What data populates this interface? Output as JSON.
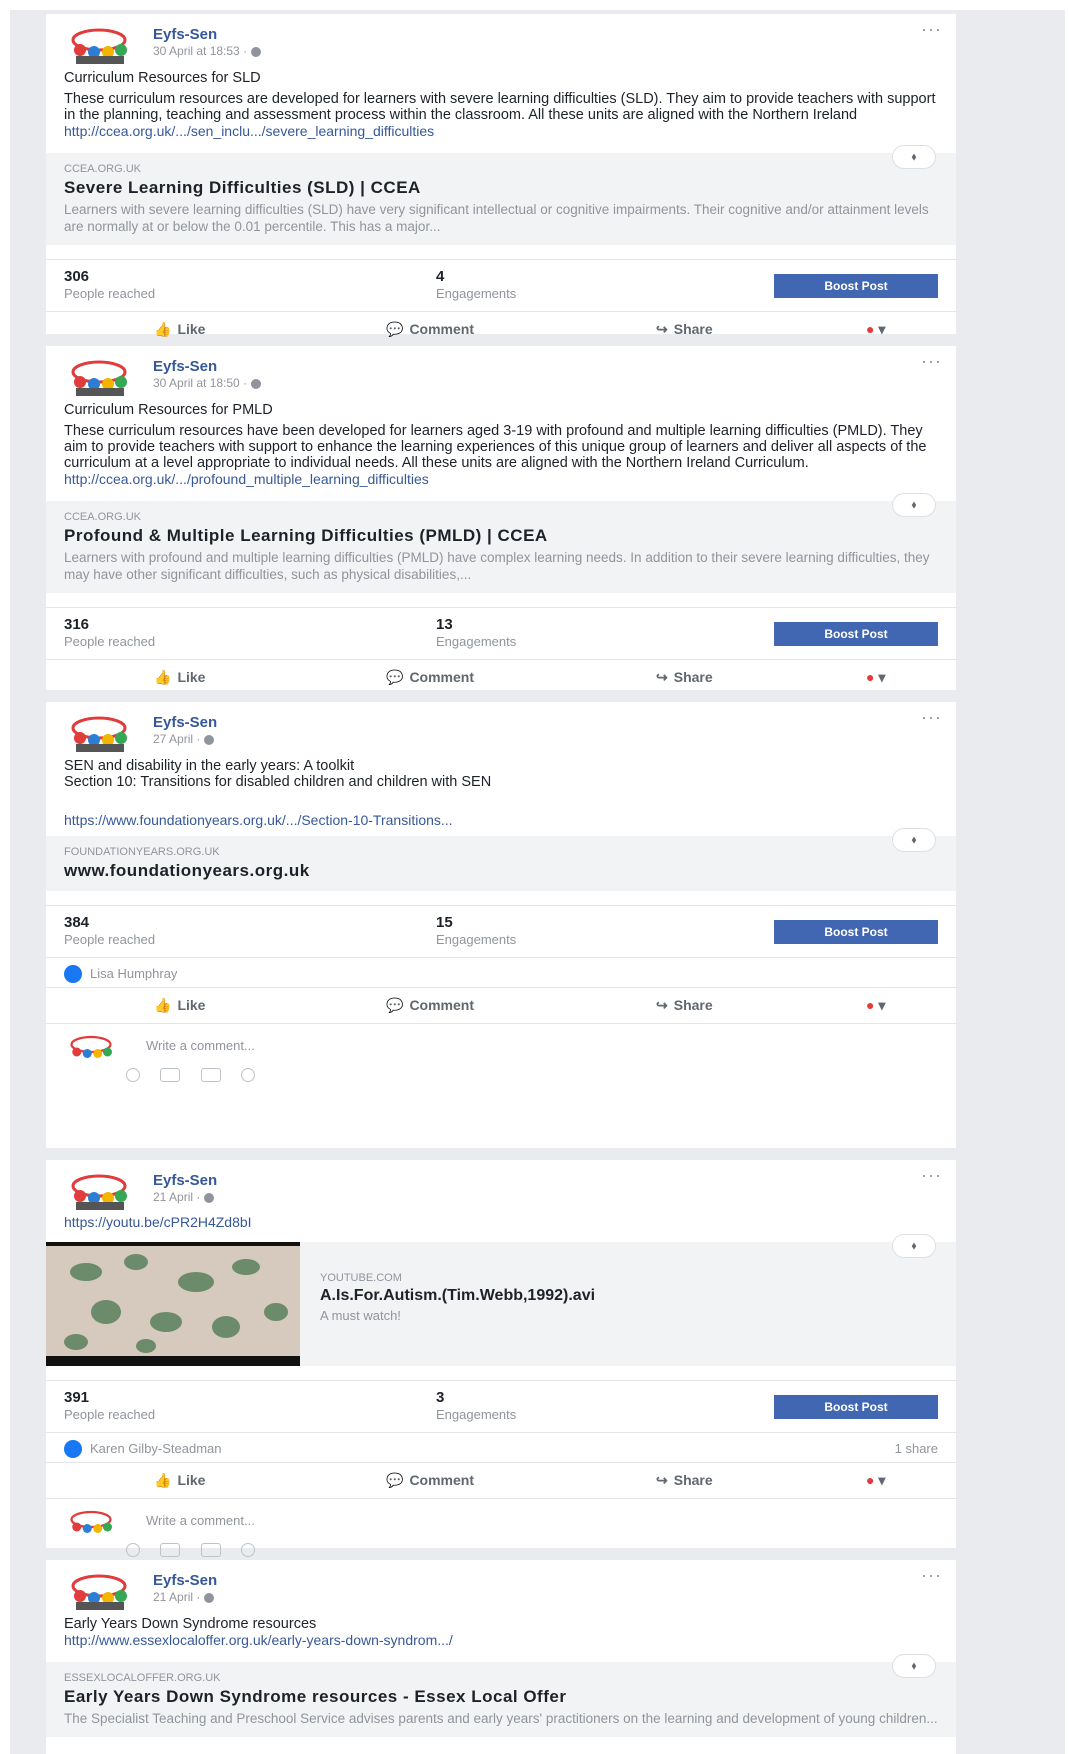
{
  "posts": [
    {
      "author": "Eyfs-Sen",
      "time": "30 April at 18:53 ·",
      "title": "Curriculum Resources for SLD",
      "body": "These curriculum resources are developed for learners with severe learning difficulties (SLD). They aim to provide teachers with support in the planning, teaching and assessment process within the classroom. All these units are aligned with the Northern Ireland",
      "link": "http://ccea.org.uk/.../sen_inclu.../severe_learning_difficulties",
      "preview_domain": "CCEA.ORG.UK",
      "preview_title": "Severe Learning Difficulties (SLD) | CCEA",
      "preview_desc": "Learners with severe learning difficulties (SLD) have very significant intellectual or cognitive impairments. Their cognitive and/or attainment levels are normally at or below the 0.01 percentile. This has a major...",
      "reached": "306",
      "reached_label": "People reached",
      "engagements": "4",
      "engagements_label": "Engagements",
      "boost": "Boost Post"
    },
    {
      "author": "Eyfs-Sen",
      "time": "30 April at 18:50 ·",
      "title": "Curriculum Resources for PMLD",
      "body": "These curriculum resources have been developed for learners aged 3-19 with profound and multiple learning difficulties (PMLD). They aim to provide teachers with support to enhance the learning experiences of this unique group of learners and deliver all aspects of the curriculum at a level appropriate to individual needs. All these units are aligned with the Northern Ireland Curriculum.",
      "link": "http://ccea.org.uk/.../profound_multiple_learning_difficulties",
      "preview_domain": "CCEA.ORG.UK",
      "preview_title": "Profound & Multiple Learning Difficulties (PMLD) | CCEA",
      "preview_desc": "Learners with profound and multiple learning difficulties (PMLD) have complex learning needs. In addition to their severe learning difficulties, they may have other significant difficulties, such as physical disabilities,...",
      "reached": "316",
      "reached_label": "People reached",
      "engagements": "13",
      "engagements_label": "Engagements",
      "boost": "Boost Post"
    },
    {
      "author": "Eyfs-Sen",
      "time": "27 April ·",
      "title": "SEN and disability in the early years: A toolkit",
      "body": "Section 10: Transitions for disabled children and children with SEN",
      "link": "https://www.foundationyears.org.uk/.../Section-10-Transitions...",
      "preview_domain": "FOUNDATIONYEARS.ORG.UK",
      "preview_title": "www.foundationyears.org.uk",
      "reached": "384",
      "reached_label": "People reached",
      "engagements": "15",
      "engagements_label": "Engagements",
      "boost": "Boost Post",
      "reactor": "Lisa Humphray",
      "comment_placeholder": "Write a comment..."
    },
    {
      "author": "Eyfs-Sen",
      "time": "21 April ·",
      "link": "https://youtu.be/cPR2H4Zd8bI",
      "preview_domain": "YOUTUBE.COM",
      "preview_title": "A.Is.For.Autism.(Tim.Webb,1992).avi",
      "preview_desc": "A must watch!",
      "reached": "391",
      "reached_label": "People reached",
      "engagements": "3",
      "engagements_label": "Engagements",
      "boost": "Boost Post",
      "reactor": "Karen Gilby-Steadman",
      "shares": "1 share",
      "comment_placeholder": "Write a comment..."
    },
    {
      "author": "Eyfs-Sen",
      "time": "21 April ·",
      "title": "Early Years Down Syndrome resources",
      "link": "http://www.essexlocaloffer.org.uk/early-years-down-syndrom.../",
      "preview_domain": "ESSEXLOCALOFFER.ORG.UK",
      "preview_title": "Early Years Down Syndrome resources - Essex Local Offer",
      "preview_desc": "The Specialist Teaching and Preschool Service advises parents and early years' practitioners on the learning and development of young children..."
    }
  ],
  "actions": {
    "like": "Like",
    "comment": "Comment",
    "share": "Share"
  },
  "colors": {
    "link": "#365899",
    "boost": "#4267b2",
    "feed_bg": "#e9ebee"
  }
}
